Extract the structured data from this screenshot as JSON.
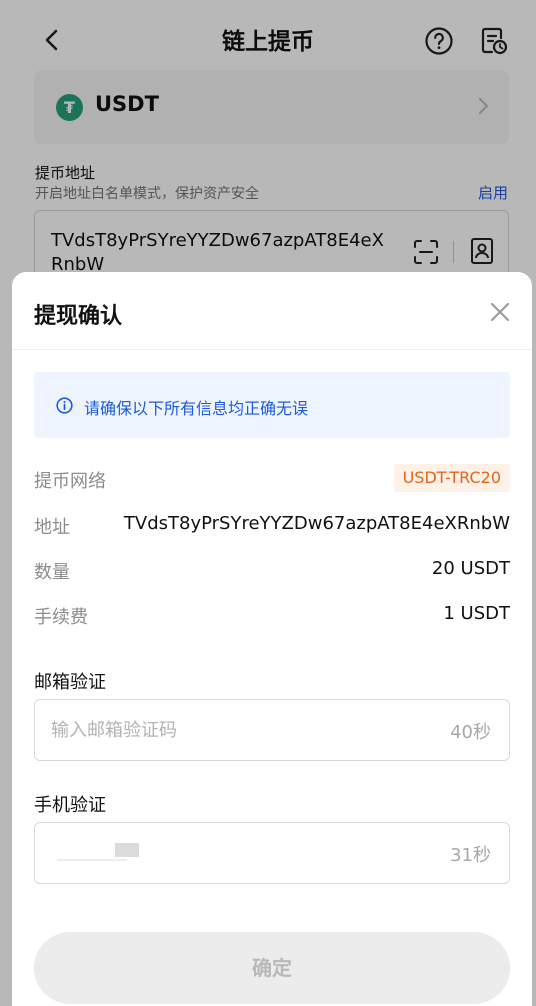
{
  "header": {
    "title": "链上提币",
    "back_icon": "chevron-left-icon",
    "help_icon": "question-circle-icon",
    "record_icon": "record-clock-icon"
  },
  "coin": {
    "symbol": "USDT",
    "logo_letter": "₮",
    "logo_color": "#26a17b"
  },
  "address_section": {
    "label": "提币地址",
    "hint": "开启地址白名单模式，保护资产安全",
    "enable_label": "启用",
    "value": "TVdsT8yPrSYreYYZDw67azpAT8E4eXRnbW"
  },
  "sheet": {
    "title": "提现确认",
    "notice": "请确保以下所有信息均正确无误",
    "rows": {
      "network": {
        "label": "提币网络",
        "value": "USDT-TRC20"
      },
      "address": {
        "label": "地址",
        "value": "TVdsT8yPrSYreYYZDw67azpAT8E4eXRnbW"
      },
      "amount": {
        "label": "数量",
        "value": "20 USDT"
      },
      "fee": {
        "label": "手续费",
        "value": "1 USDT"
      }
    },
    "email_verify": {
      "label": "邮箱验证",
      "placeholder": "输入邮箱验证码",
      "value": "",
      "timer": "40秒"
    },
    "phone_verify": {
      "label": "手机验证",
      "value": "",
      "timer": "31秒"
    },
    "confirm_label": "确定"
  },
  "colors": {
    "accent_blue": "#1f5bd8",
    "network_orange": "#e3661b",
    "notice_bg": "#eef4fd"
  }
}
